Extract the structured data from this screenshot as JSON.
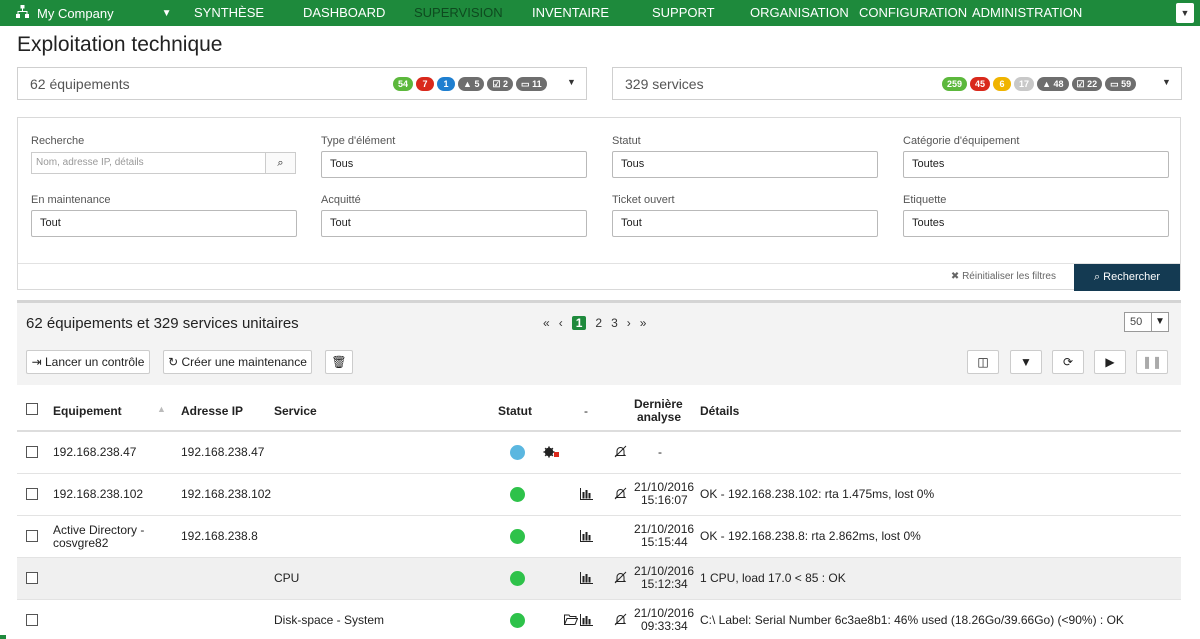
{
  "topnav": {
    "company": "My Company",
    "menu": [
      "SYNTHÈSE",
      "DASHBOARD",
      "SUPERVISION",
      "INVENTAIRE",
      "SUPPORT",
      "ORGANISATION",
      "CONFIGURATION",
      "ADMINISTRATION"
    ],
    "active": "SUPERVISION",
    "bar_color": "#1e8a3c"
  },
  "page_title": "Exploitation technique",
  "equipment_summary": {
    "label": "62 équipements",
    "badges": [
      {
        "text": "54",
        "color": "#5cb83c"
      },
      {
        "text": "7",
        "color": "#d9291c"
      },
      {
        "text": "1",
        "color": "#1f7fd0"
      },
      {
        "text": "5",
        "icon": "warning-icon",
        "color": "#6e6e6e"
      },
      {
        "text": "2",
        "icon": "check-box-icon",
        "color": "#6e6e6e"
      },
      {
        "text": "11",
        "icon": "folder-icon",
        "color": "#6e6e6e"
      }
    ]
  },
  "service_summary": {
    "label": "329 services",
    "badges": [
      {
        "text": "259",
        "color": "#5cb83c"
      },
      {
        "text": "45",
        "color": "#d9291c"
      },
      {
        "text": "6",
        "color": "#f0b400"
      },
      {
        "text": "17",
        "color": "#c8c8c8"
      },
      {
        "text": "48",
        "icon": "warning-icon",
        "color": "#6e6e6e"
      },
      {
        "text": "22",
        "icon": "check-box-icon",
        "color": "#6e6e6e"
      },
      {
        "text": "59",
        "icon": "folder-icon",
        "color": "#6e6e6e"
      }
    ]
  },
  "filters": {
    "search_label": "Recherche",
    "search_placeholder": "Nom, adresse IP, détails",
    "type_label": "Type d'élément",
    "type_value": "Tous",
    "status_label": "Statut",
    "status_value": "Tous",
    "category_label": "Catégorie d'équipement",
    "category_value": "Toutes",
    "maintenance_label": "En maintenance",
    "maintenance_value": "Tout",
    "ack_label": "Acquitté",
    "ack_value": "Tout",
    "ticket_label": "Ticket ouvert",
    "ticket_value": "Tout",
    "tag_label": "Etiquette",
    "tag_value": "Toutes",
    "reset_label": "Réinitialiser les filtres",
    "submit_label": "Rechercher"
  },
  "results": {
    "title": "62 équipements et 329 services unitaires",
    "pages": [
      "1",
      "2",
      "3"
    ],
    "current_page": "1",
    "page_size": "50",
    "launch_check_label": "Lancer un contrôle",
    "create_maintenance_label": "Créer une maintenance",
    "columns": {
      "equipment": "Equipement",
      "ip": "Adresse IP",
      "service": "Service",
      "status": "Statut",
      "dash": "-",
      "last_analysis_1": "Dernière",
      "last_analysis_2": "analyse",
      "details": "Détails"
    },
    "rows": [
      {
        "equipment_1": "192.168.238.47",
        "equipment_2": "",
        "ip": "192.168.238.47",
        "service": "",
        "status_color": "#5bb7e0",
        "date": "",
        "time": "-",
        "details": "",
        "icons": [
          "gear-icon",
          "bell-slash-icon"
        ]
      },
      {
        "equipment_1": "192.168.238.102",
        "equipment_2": "",
        "ip": "192.168.238.102",
        "service": "",
        "status_color": "#2ec24a",
        "date": "21/10/2016",
        "time": "15:16:07",
        "details": "OK - 192.168.238.102: rta 1.475ms, lost 0%",
        "icons": [
          "chart-icon",
          "bell-slash-icon"
        ]
      },
      {
        "equipment_1": "Active Directory -",
        "equipment_2": "cosvgre82",
        "ip": "192.168.238.8",
        "service": "",
        "status_color": "#2ec24a",
        "date": "21/10/2016",
        "time": "15:15:44",
        "details": "OK - 192.168.238.8: rta 2.862ms, lost 0%",
        "icons": [
          "chart-icon"
        ]
      },
      {
        "equipment_1": "",
        "equipment_2": "",
        "ip": "",
        "service": "CPU",
        "status_color": "#2ec24a",
        "date": "21/10/2016",
        "time": "15:12:34",
        "details": "1 CPU, load 17.0 < 85 : OK",
        "icons": [
          "chart-icon",
          "bell-slash-icon"
        ]
      },
      {
        "equipment_1": "",
        "equipment_2": "",
        "ip": "",
        "service": "Disk-space - System",
        "status_color": "#2ec24a",
        "date": "21/10/2016",
        "time": "09:33:34",
        "details": "C:\\ Label: Serial Number 6c3ae8b1: 46% used (18.26Go/39.66Go) (<90%) : OK",
        "icons": [
          "folder-icon",
          "chart-icon",
          "bell-slash-icon"
        ]
      }
    ]
  }
}
